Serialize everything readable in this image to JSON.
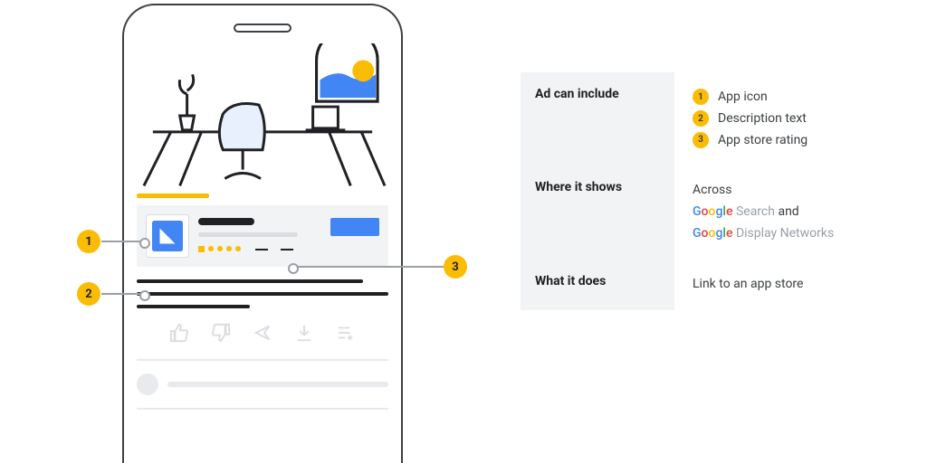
{
  "callouts": {
    "c1": "1",
    "c2": "2",
    "c3": "3"
  },
  "table": {
    "r1": {
      "label": "Ad can include",
      "i1": "App icon",
      "i2": "Description text",
      "i3": "App store rating"
    },
    "r2": {
      "label": "Where it shows",
      "lead": "Across",
      "search": "Search",
      "and": "and",
      "display": "Display Networks"
    },
    "r3": {
      "label": "What it does",
      "val": "Link to an app store"
    }
  },
  "google": {
    "g": "G",
    "o1": "o",
    "o2": "o",
    "g2": "g",
    "l": "l",
    "e": "e"
  }
}
